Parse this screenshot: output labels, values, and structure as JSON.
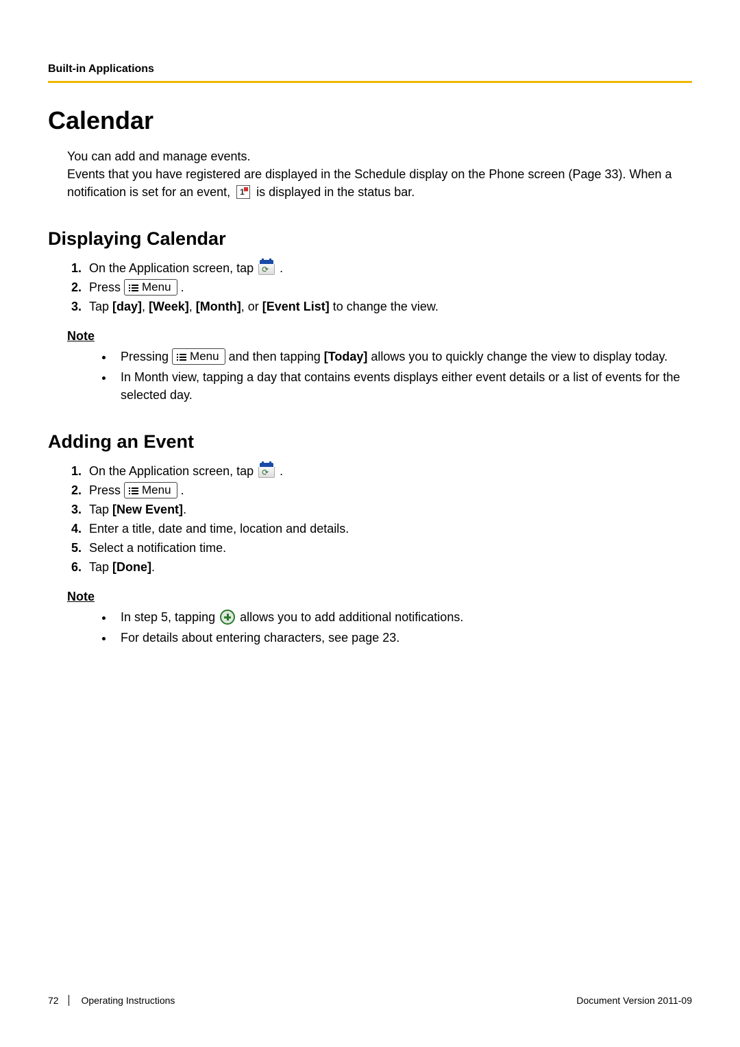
{
  "header": {
    "section": "Built-in Applications"
  },
  "title": "Calendar",
  "intro": {
    "line1": "You can add and manage events.",
    "line2a": "Events that you have registered are displayed in the Schedule display on the Phone screen (Page 33). When a notification is set for an event, ",
    "line2b": " is displayed in the status bar."
  },
  "menu_label": "Menu",
  "section_display": {
    "heading": "Displaying Calendar",
    "steps": {
      "s1": "On the Application screen, tap ",
      "s1_end": ".",
      "s2_pre": "Press ",
      "s2_post": ".",
      "s3_pre": "Tap ",
      "s3_b1": "[day]",
      "s3_m1": ", ",
      "s3_b2": "[Week]",
      "s3_m2": ", ",
      "s3_b3": "[Month]",
      "s3_m3": ", or ",
      "s3_b4": "[Event List]",
      "s3_post": " to change the view."
    },
    "note_label": "Note",
    "notes": {
      "n1_pre": "Pressing ",
      "n1_mid": " and then tapping ",
      "n1_b": "[Today]",
      "n1_post": " allows you to quickly change the view to display today.",
      "n2": "In Month view, tapping a day that contains events displays either event details or a list of events for the selected day."
    }
  },
  "section_add": {
    "heading": "Adding an Event",
    "steps": {
      "s1": "On the Application screen, tap ",
      "s1_end": ".",
      "s2_pre": "Press ",
      "s2_post": ".",
      "s3_pre": "Tap ",
      "s3_b": "[New Event]",
      "s3_post": ".",
      "s4": "Enter a title, date and time, location and details.",
      "s5": "Select a notification time.",
      "s6_pre": "Tap ",
      "s6_b": "[Done]",
      "s6_post": "."
    },
    "note_label": "Note",
    "notes": {
      "n1_pre": "In step 5, tapping ",
      "n1_post": " allows you to add additional notifications.",
      "n2": "For details about entering characters, see page 23."
    }
  },
  "footer": {
    "page_number": "72",
    "doc_title": "Operating Instructions",
    "version_label": "Document Version  2011-09"
  }
}
